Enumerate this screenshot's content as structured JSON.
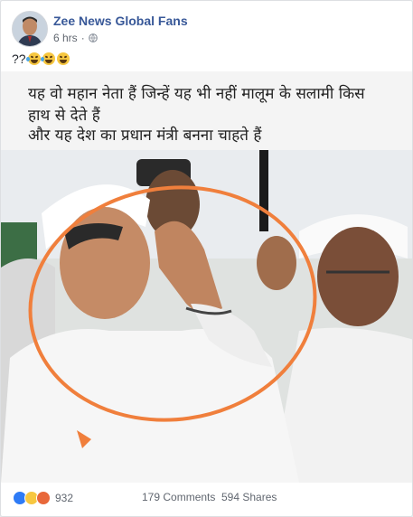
{
  "post": {
    "page_name": "Zee News Global Fans",
    "timestamp": "6 hrs",
    "separator": "·",
    "privacy_icon": "globe-icon",
    "caption_text": "??",
    "caption_emojis": [
      "rolling-on-floor-laughing-emoji",
      "rolling-on-floor-laughing-emoji",
      "grinning-emoji"
    ]
  },
  "image": {
    "text_lines": [
      "यह वो महान नेता हैं जिन्हें यह भी नहीं मालूम के सलामी किस",
      "हाथ से देते हैं",
      "और यह देश का प्रधान मंत्री बनना चाहते हैं"
    ],
    "annotation_color": "#f07f3c"
  },
  "footer": {
    "reaction_icons": [
      "like-icon",
      "haha-icon",
      "angry-icon"
    ],
    "reaction_count": "932",
    "comments": "179 Comments",
    "shares": "594 Shares"
  },
  "colors": {
    "link_blue": "#385898",
    "meta_gray": "#616770",
    "background": "#e9ebee"
  }
}
